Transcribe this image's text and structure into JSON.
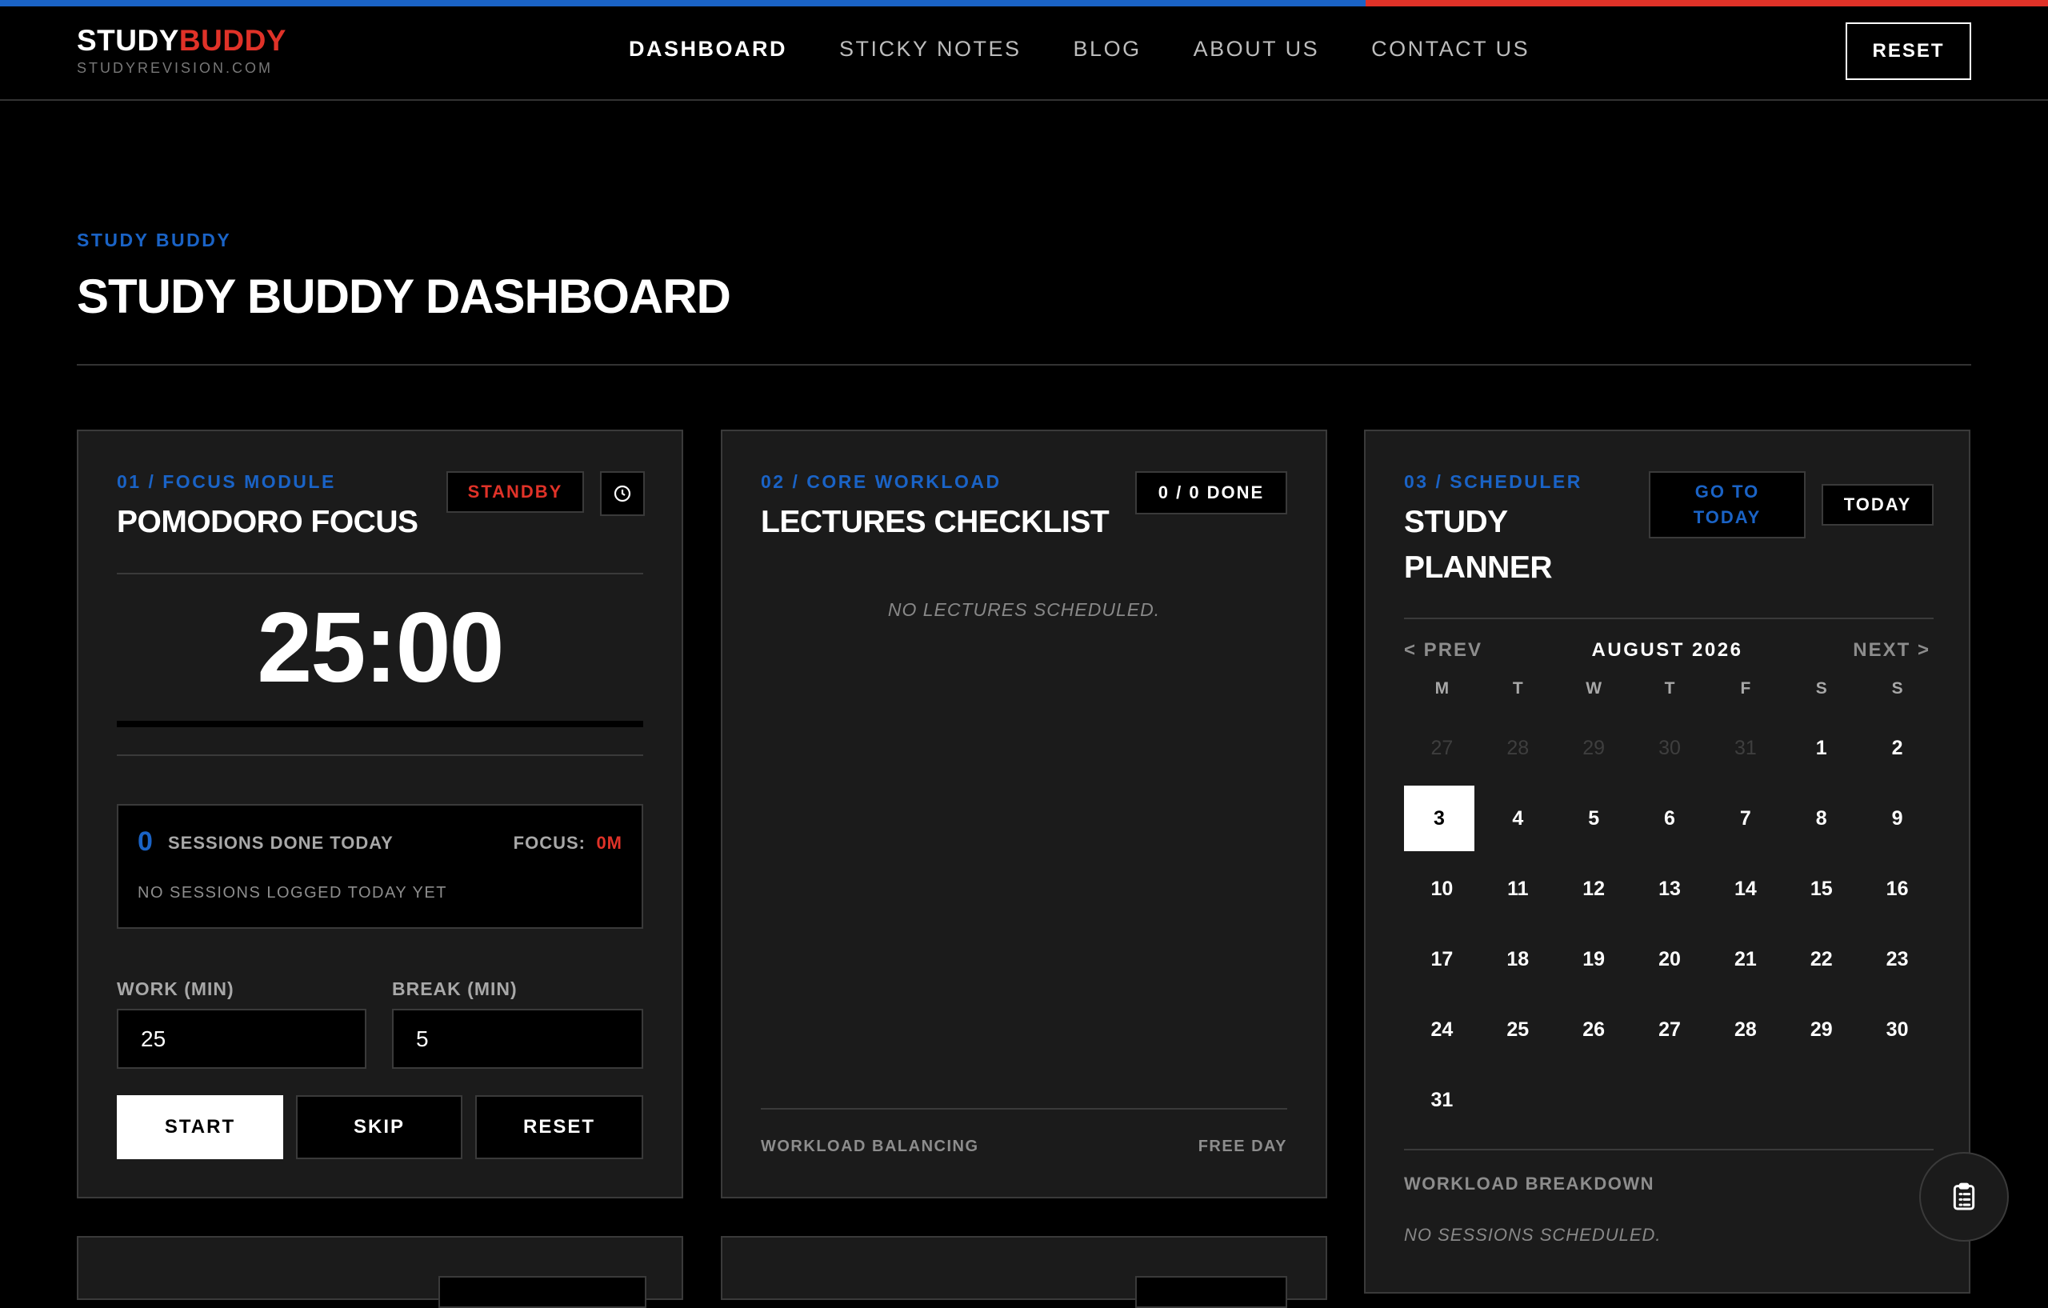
{
  "header": {
    "logo_main_a": "STUDY",
    "logo_main_b": "BUDDY",
    "logo_sub": "STUDYREVISION.COM",
    "nav": [
      "DASHBOARD",
      "STICKY NOTES",
      "BLOG",
      "ABOUT US",
      "CONTACT US"
    ],
    "reset_label": "RESET"
  },
  "page": {
    "eyebrow": "STUDY BUDDY",
    "title": "STUDY BUDDY DASHBOARD"
  },
  "focus": {
    "label": "01 / FOCUS MODULE",
    "title": "POMODORO FOCUS",
    "status": "STANDBY",
    "timer": "25:00",
    "sessions_count": "0",
    "sessions_label": "SESSIONS DONE TODAY",
    "focus_label": "FOCUS:",
    "focus_value": "0M",
    "sessions_note": "NO SESSIONS LOGGED TODAY YET",
    "work_label": "WORK (MIN)",
    "work_value": "25",
    "break_label": "BREAK (MIN)",
    "break_value": "5",
    "start": "START",
    "skip": "SKIP",
    "reset": "RESET"
  },
  "workload": {
    "label": "02 / CORE WORKLOAD",
    "title": "LECTURES CHECKLIST",
    "done": "0 / 0 DONE",
    "empty": "NO LECTURES SCHEDULED.",
    "footer_left": "WORKLOAD BALANCING",
    "footer_right": "FREE DAY"
  },
  "scheduler": {
    "label": "03 / SCHEDULER",
    "title_line1": "STUDY",
    "title_line2": "PLANNER",
    "go_today_line1": "GO TO",
    "go_today_line2": "TODAY",
    "today": "TODAY",
    "prev": "< PREV",
    "month": "AUGUST 2026",
    "next": "NEXT >",
    "weekdays": [
      "M",
      "T",
      "W",
      "T",
      "F",
      "S",
      "S"
    ],
    "weeks": [
      [
        "27",
        "28",
        "29",
        "30",
        "31",
        "1",
        "2"
      ],
      [
        "3",
        "4",
        "5",
        "6",
        "7",
        "8",
        "9"
      ],
      [
        "10",
        "11",
        "12",
        "13",
        "14",
        "15",
        "16"
      ],
      [
        "17",
        "18",
        "19",
        "20",
        "21",
        "22",
        "23"
      ],
      [
        "24",
        "25",
        "26",
        "27",
        "28",
        "29",
        "30"
      ],
      [
        "31",
        "",
        "",
        "",
        "",
        "",
        ""
      ]
    ],
    "muted_first_row_count": 5,
    "today_day": "3",
    "breakdown_label": "WORKLOAD BREAKDOWN",
    "breakdown_empty": "NO SESSIONS SCHEDULED."
  },
  "colors": {
    "accent_blue": "#1a63c6",
    "accent_red": "#e03228",
    "card_bg": "#1b1b1b"
  }
}
